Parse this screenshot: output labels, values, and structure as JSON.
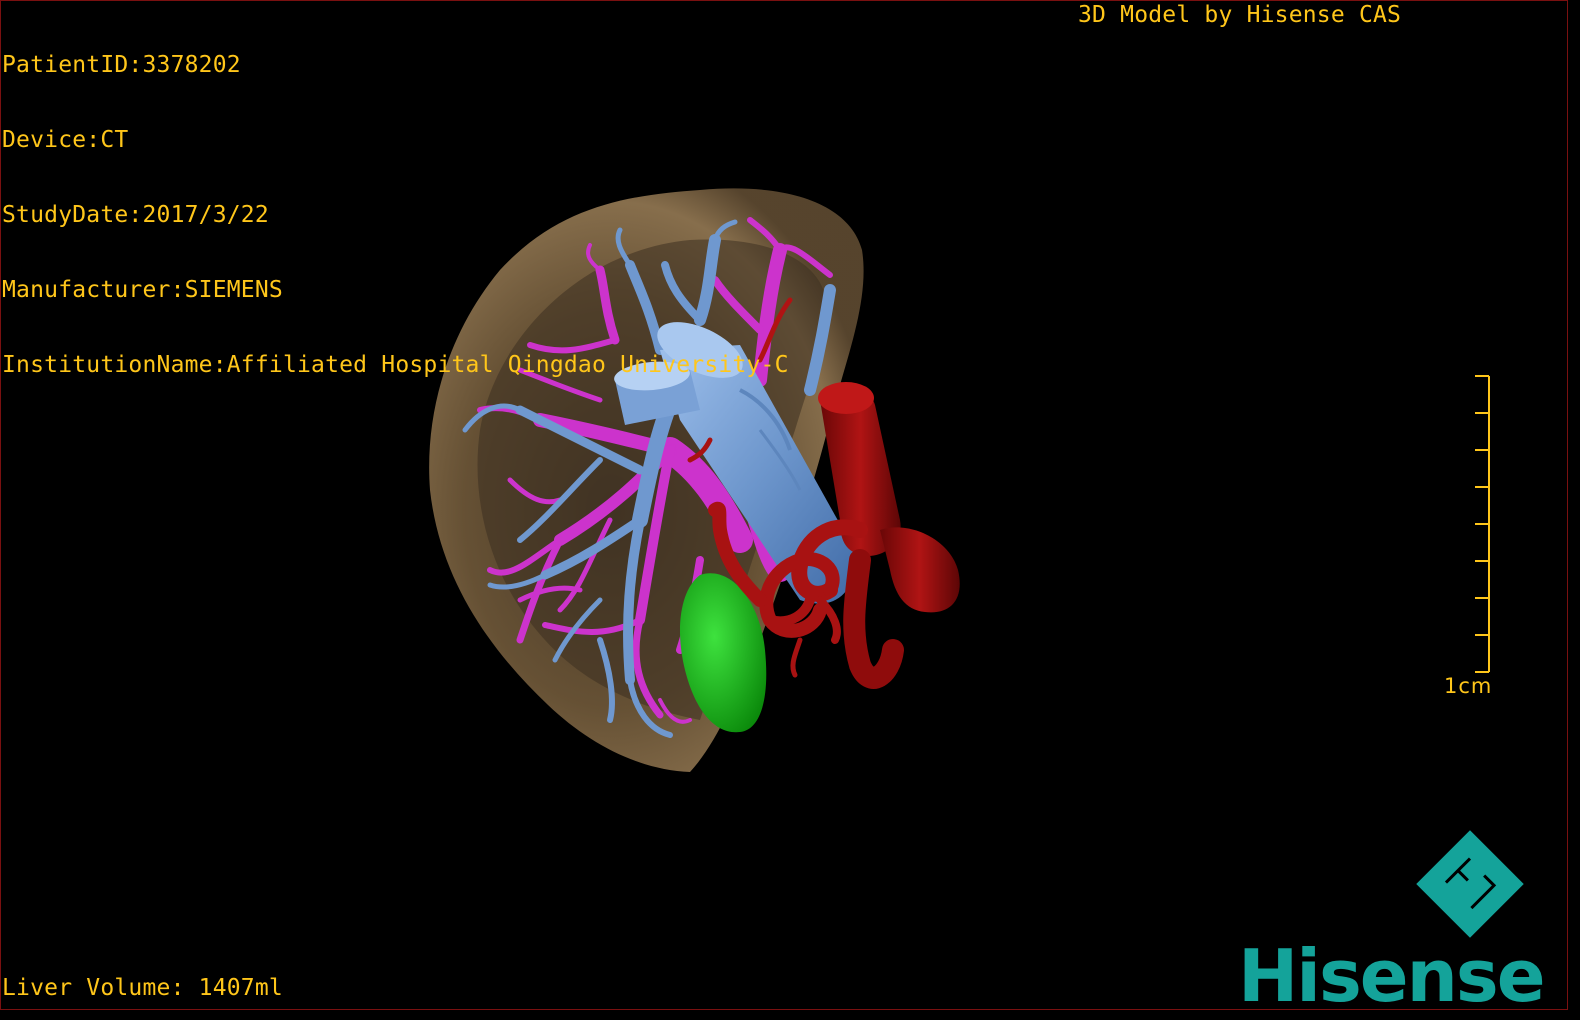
{
  "header": {
    "patient_id": "PatientID:3378202",
    "device": "Device:CT",
    "study_date": "StudyDate:2017/3/22",
    "manufacturer": "Manufacturer:SIEMENS",
    "institution": "InstitutionName:Affiliated Hospital Qingdao University-C",
    "model_credit": "3D Model by Hisense CAS"
  },
  "footer": {
    "liver_volume": "Liver Volume: 1407ml"
  },
  "scale_bar": {
    "label": "1cm"
  },
  "brand": {
    "name": "Hisense",
    "logo_icon": "hisense-hc-diamond-icon"
  },
  "colors": {
    "overlay_text": "#ffc61a",
    "background": "#000000",
    "liver_surface": "#8a7150",
    "hepatic_vein": "#6f98cf",
    "portal_vein": "#cc33cc",
    "artery": "#9c0e0e",
    "gallbladder": "#12b012",
    "brand": "#14a39a"
  }
}
